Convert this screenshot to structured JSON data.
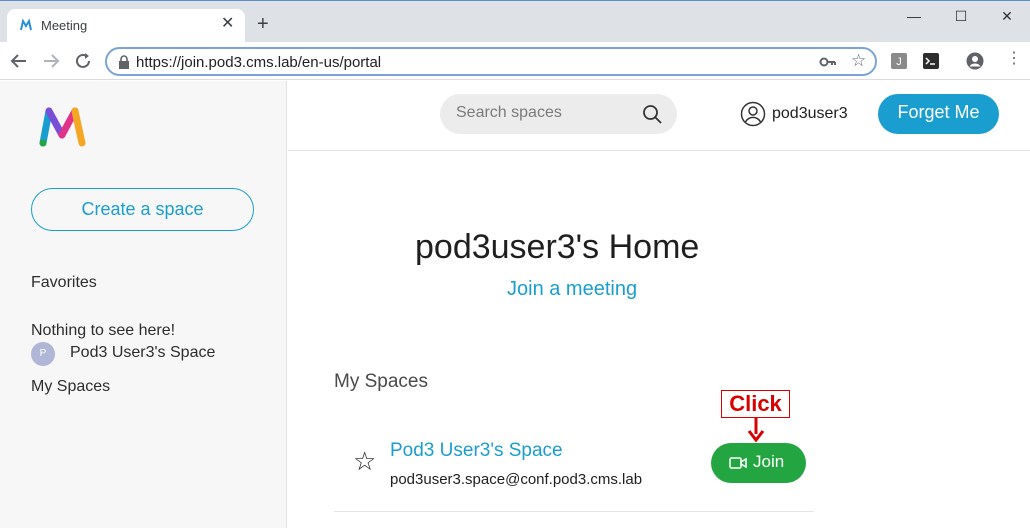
{
  "browser": {
    "tab_title": "Meeting",
    "url": "https://join.pod3.cms.lab/en-us/portal"
  },
  "sidebar": {
    "create_label": "Create a space",
    "favorites_heading": "Favorites",
    "favorites_empty": "Nothing to see here!",
    "spaces_heading": "My Spaces",
    "spaces": [
      {
        "avatar_initial": "P",
        "label": "Pod3 User3's Space"
      }
    ]
  },
  "header": {
    "search_placeholder": "Search spaces",
    "username": "pod3user3",
    "forget_label": "Forget Me"
  },
  "main": {
    "title": "pod3user3's Home",
    "join_link": "Join a meeting",
    "spaces_heading": "My Spaces",
    "space": {
      "name": "Pod3 User3's Space",
      "address": "pod3user3.space@conf.pod3.cms.lab",
      "join_label": "Join"
    }
  },
  "annotation": {
    "text": "Click"
  },
  "colors": {
    "accent": "#1a9ecf",
    "join_green": "#23a641",
    "annotation_red": "#d80000"
  }
}
